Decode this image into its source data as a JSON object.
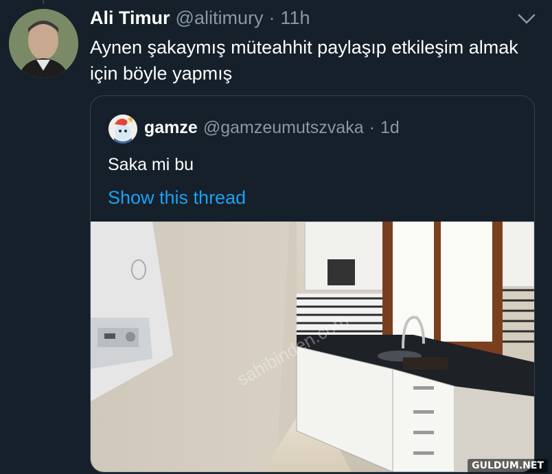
{
  "tweet": {
    "author_name": "Ali Timur",
    "author_handle": "@alitimury",
    "separator": "·",
    "time": "11h",
    "text": "Aynen şakaymış müteahhit paylaşıp etkileşim almak için böyle yapmış"
  },
  "quoted_tweet": {
    "author_name": "gamze",
    "author_handle": "@gamzeumutszvaka",
    "separator": "·",
    "time": "1d",
    "text": "Saka mi bu",
    "thread_link": "Show this thread",
    "photo_watermark": "sahibinden.com"
  },
  "site_watermark": "GULDUM.NET",
  "icons": {
    "more": "chevron-down-icon"
  },
  "colors": {
    "background": "#15202b",
    "secondary_text": "#8899a6",
    "link": "#1da1f2",
    "border": "#38444d"
  }
}
